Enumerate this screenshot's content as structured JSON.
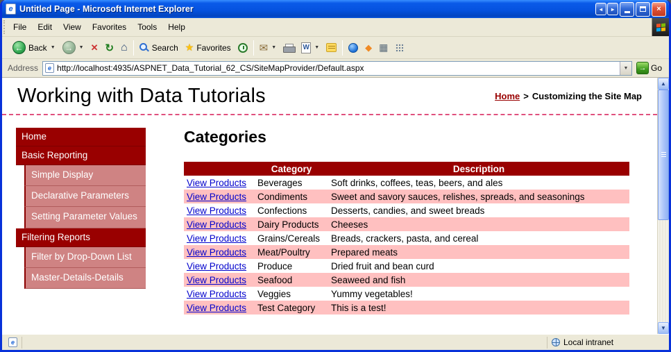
{
  "window": {
    "title": "Untitled Page - Microsoft Internet Explorer",
    "menu": [
      "File",
      "Edit",
      "View",
      "Favorites",
      "Tools",
      "Help"
    ],
    "status_right": "Local intranet"
  },
  "toolbar": {
    "back_label": "Back",
    "search_label": "Search",
    "favorites_label": "Favorites"
  },
  "addressbar": {
    "label": "Address",
    "url": "http://localhost:4935/ASPNET_Data_Tutorial_62_CS/SiteMapProvider/Default.aspx",
    "go_label": "Go"
  },
  "icons": {
    "back_arrow": "←",
    "forward_arrow": "→",
    "stop": "✕",
    "refresh": "↻",
    "home": "⌂",
    "star": "★",
    "mail": "✉",
    "word": "W",
    "diamond": "◆",
    "building": "▦",
    "caret": "▼",
    "up": "▲",
    "down": "▼",
    "left": "◂",
    "right": "▸",
    "close": "×",
    "go_arrow": "→",
    "ie_e": "e"
  },
  "page": {
    "title": "Working with Data Tutorials",
    "breadcrumb": {
      "home": "Home",
      "separator": ">",
      "current": "Customizing the Site Map"
    },
    "sidebar": {
      "items": [
        {
          "label": "Home",
          "level": 1
        },
        {
          "label": "Basic Reporting",
          "level": 1
        },
        {
          "label": "Simple Display",
          "level": 2
        },
        {
          "label": "Declarative Parameters",
          "level": 2
        },
        {
          "label": "Setting Parameter Values",
          "level": 2
        },
        {
          "label": "Filtering Reports",
          "level": 1
        },
        {
          "label": "Filter by Drop-Down List",
          "level": 2
        },
        {
          "label": "Master-Details-Details",
          "level": 2
        }
      ]
    },
    "main": {
      "heading": "Categories",
      "table": {
        "link_label": "View Products",
        "headers": [
          "Category",
          "Description"
        ],
        "rows": [
          {
            "category": "Beverages",
            "description": "Soft drinks, coffees, teas, beers, and ales"
          },
          {
            "category": "Condiments",
            "description": "Sweet and savory sauces, relishes, spreads, and seasonings"
          },
          {
            "category": "Confections",
            "description": "Desserts, candies, and sweet breads"
          },
          {
            "category": "Dairy Products",
            "description": "Cheeses"
          },
          {
            "category": "Grains/Cereals",
            "description": "Breads, crackers, pasta, and cereal"
          },
          {
            "category": "Meat/Poultry",
            "description": "Prepared meats"
          },
          {
            "category": "Produce",
            "description": "Dried fruit and bean curd"
          },
          {
            "category": "Seafood",
            "description": "Seaweed and fish"
          },
          {
            "category": "Veggies",
            "description": "Yummy vegetables!"
          },
          {
            "category": "Test Category",
            "description": "This is a test!"
          }
        ]
      }
    }
  },
  "colors": {
    "maroon": "#990000",
    "row_pink": "#ffc0c0",
    "sidebar_light": "#cf8383",
    "titlebar_blue": "#0653e0",
    "link_blue": "#0000cc",
    "dashed_line_pink": "#e0507e"
  }
}
